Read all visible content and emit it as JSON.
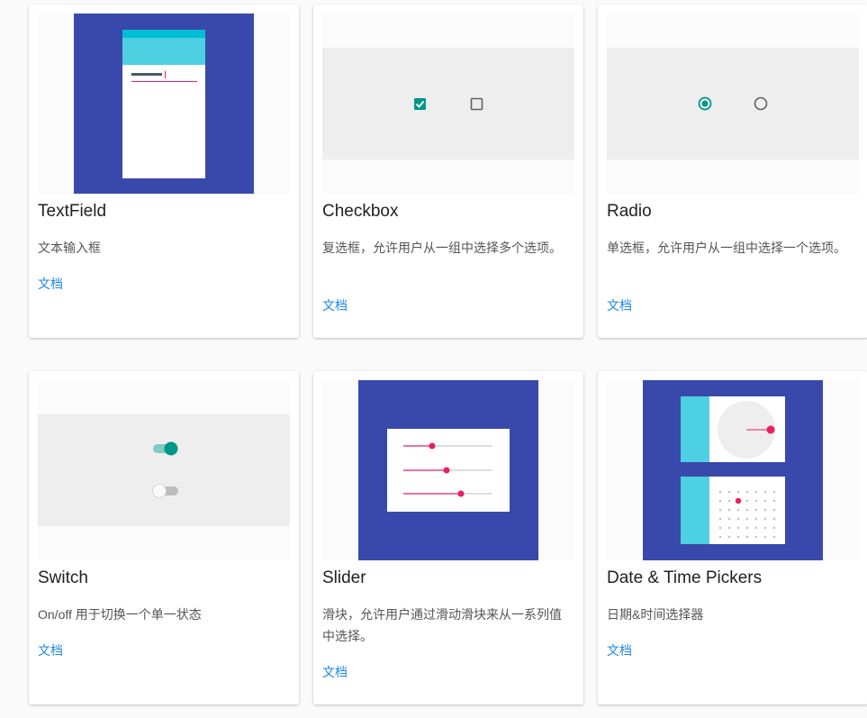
{
  "colors": {
    "primary": "#3949ab",
    "accent": "#e91e63",
    "teal": "#009688",
    "cyan": "#4dd0e1",
    "link": "#1e88e5"
  },
  "cards": [
    {
      "title": "TextField",
      "desc": "文本输入框",
      "link": "文档"
    },
    {
      "title": "Checkbox",
      "desc": "复选框，允许用户从一组中选择多个选项。",
      "link": "文档"
    },
    {
      "title": "Radio",
      "desc": "单选框，允许用户从一组中选择一个选项。",
      "link": "文档"
    },
    {
      "title": "Switch",
      "desc": "On/off 用于切换一个单一状态",
      "link": "文档"
    },
    {
      "title": "Slider",
      "desc": "滑块，允许用户通过滑动滑块来从一系列值中选择。",
      "link": "文档"
    },
    {
      "title": "Date & Time Pickers",
      "desc": "日期&时间选择器",
      "link": "文档"
    }
  ],
  "icons": {
    "checkbox_checked": "checkbox-checked-icon",
    "checkbox_unchecked": "checkbox-unchecked-icon",
    "radio_selected": "radio-selected-icon",
    "radio_unselected": "radio-unselected-icon"
  }
}
